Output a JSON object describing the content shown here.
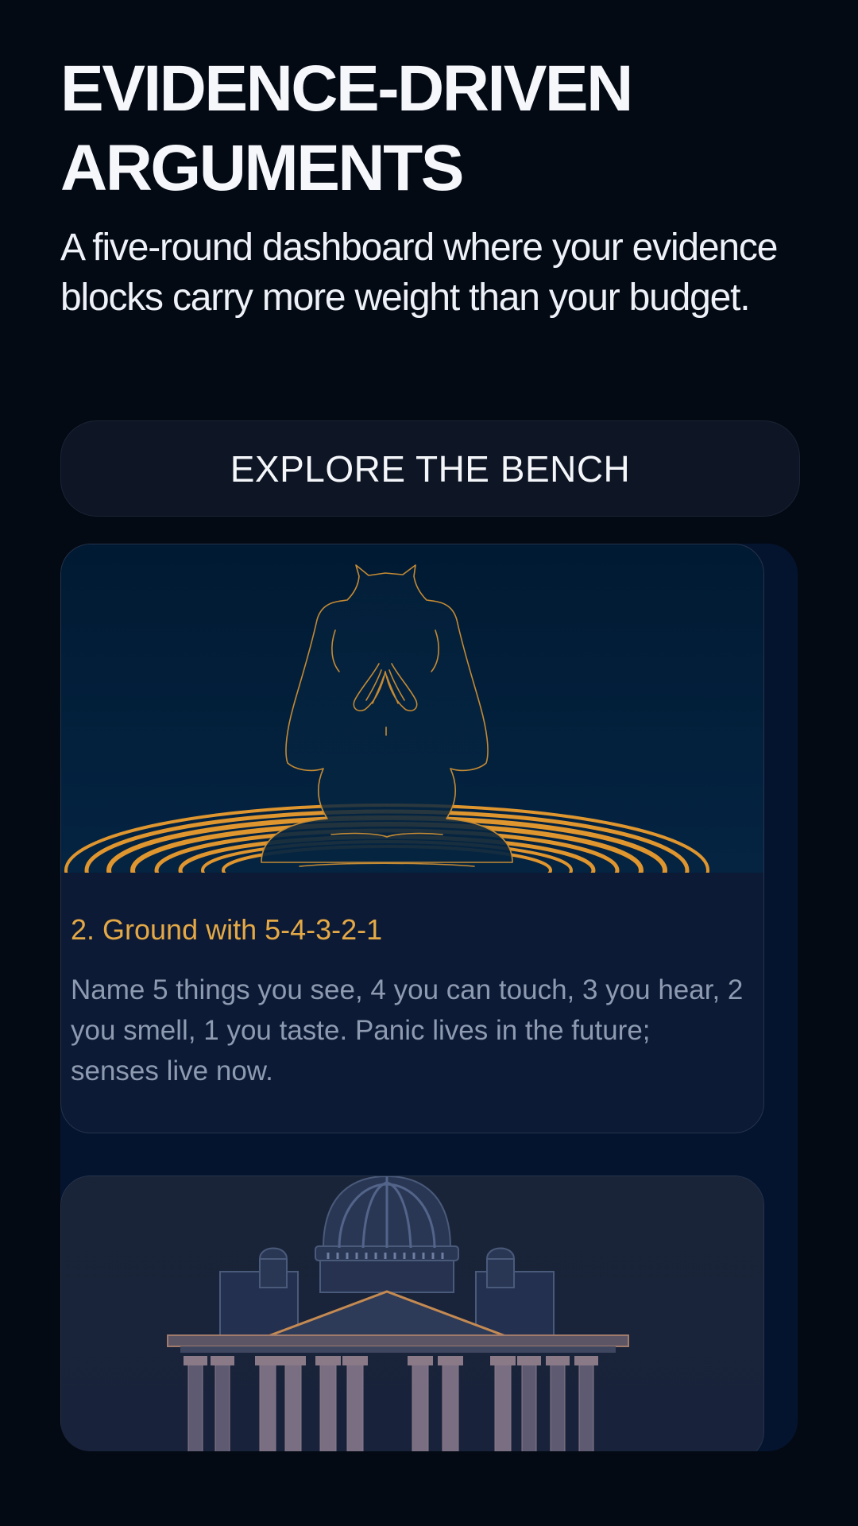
{
  "hero": {
    "title_line1": "EVIDENCE-DRIVEN",
    "title_line2": "ARGUMENTS",
    "subtitle": "A five-round dashboard where your evidence blocks carry more weight than your budget."
  },
  "cta": {
    "label": "EXPLORE THE BENCH"
  },
  "cards": [
    {
      "title": "2. Ground with 5-4-3-2-1",
      "body": "Name 5 things you see, 4 you can touch, 3 you hear, 2 you smell, 1 you taste. Panic lives in the future; senses live now.",
      "icon": "meditating-figure-icon"
    },
    {
      "icon": "courthouse-icon"
    }
  ],
  "colors": {
    "background": "#040a14",
    "card": "#0d1a35",
    "accent": "#e4a946",
    "body_text": "#8d9ab0"
  }
}
